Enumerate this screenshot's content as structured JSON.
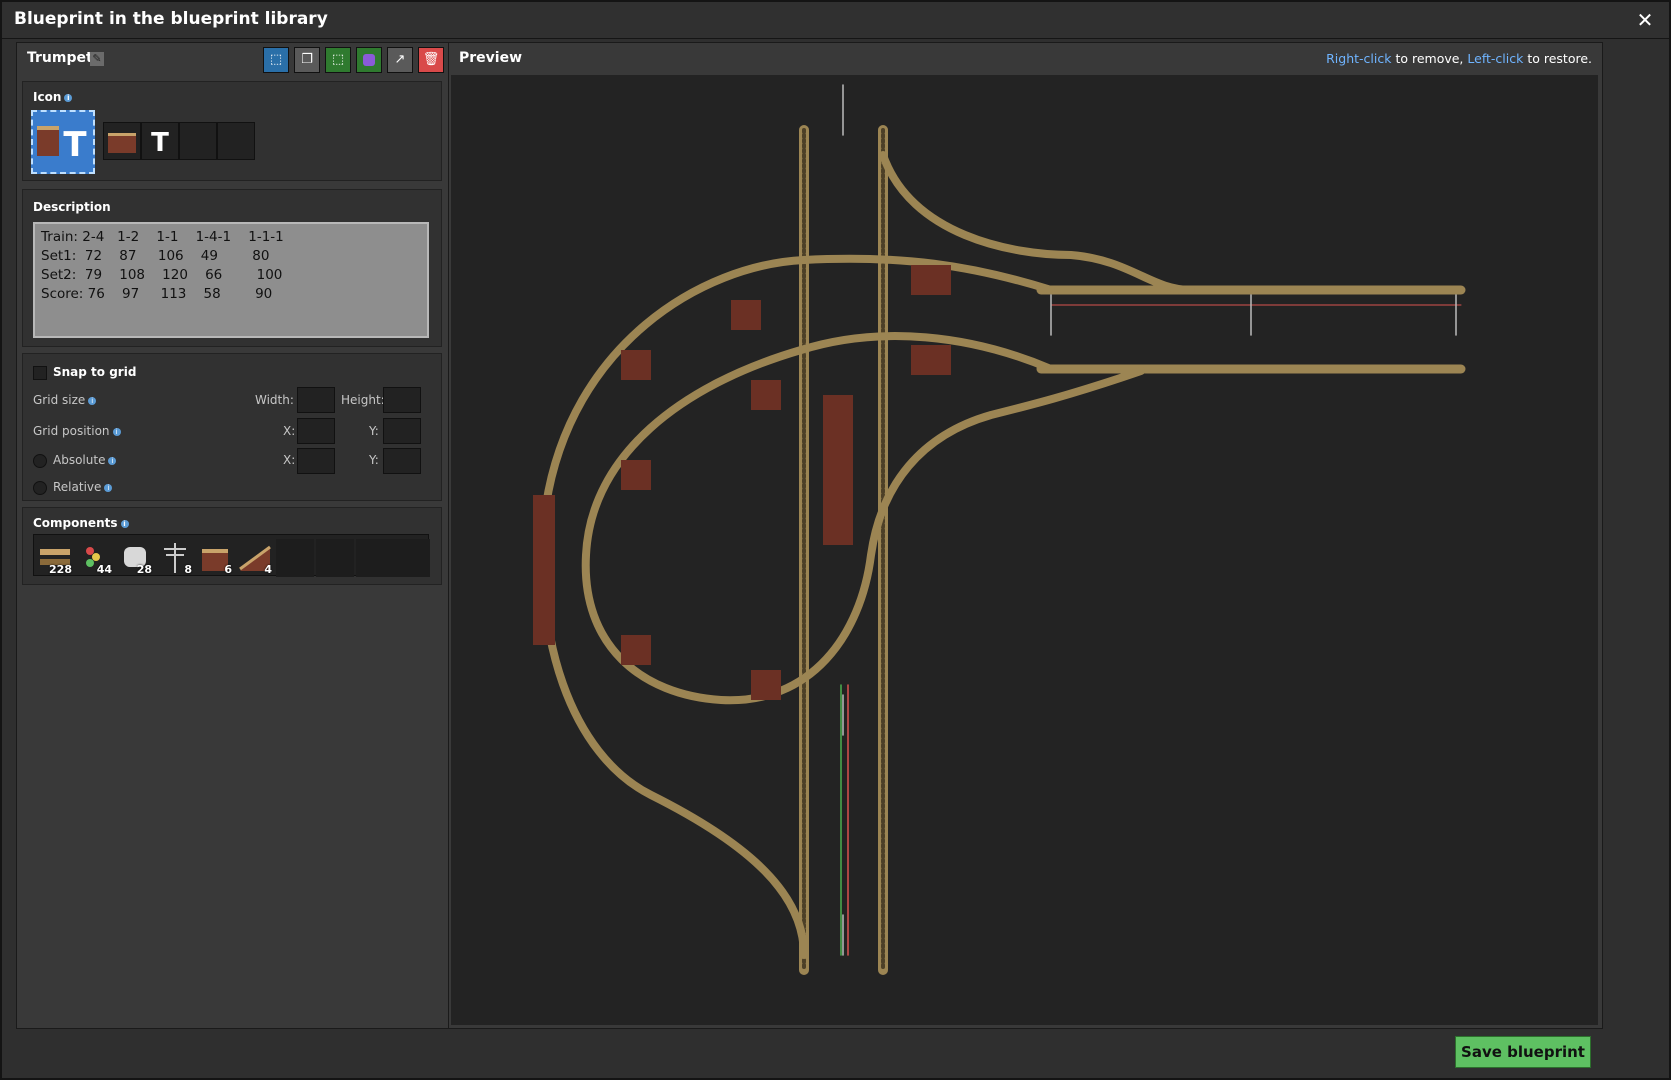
{
  "window": {
    "title": "Blueprint in the blueprint library"
  },
  "blueprint": {
    "name": "Trumpet"
  },
  "icon_section": {
    "title": "Icon"
  },
  "description": {
    "title": "Description",
    "lines": [
      "Train: 2-4   1-2    1-1    1-4-1    1-1-1",
      "Set1:  72    87     106    49        80",
      "Set2:  79    108    120    66        100",
      "Score: 76    97     113    58        90"
    ]
  },
  "grid": {
    "snap_label": "Snap to grid",
    "grid_size_label": "Grid size",
    "width_label": "Width:",
    "height_label": "Height:",
    "grid_position_label": "Grid position",
    "x_label": "X:",
    "y_label": "Y:",
    "absolute_label": "Absolute",
    "relative_label": "Relative"
  },
  "components": {
    "title": "Components",
    "items": [
      {
        "icon": "rail-icon",
        "count": "228"
      },
      {
        "icon": "rail-signal-icon",
        "count": "44"
      },
      {
        "icon": "rail-chain-signal-icon",
        "count": "28"
      },
      {
        "icon": "big-electric-pole-icon",
        "count": "8"
      },
      {
        "icon": "rail-support-icon",
        "count": "6"
      },
      {
        "icon": "elevated-rail-ramp-icon",
        "count": "4"
      }
    ]
  },
  "preview": {
    "title": "Preview",
    "hint": {
      "k1": "Right-click",
      "t1": " to remove, ",
      "k2": "Left-click",
      "t2": " to restore."
    }
  },
  "actions": {
    "save_label": "Save blueprint"
  },
  "colors": {
    "accent_blue": "#6fb4ff",
    "save_green": "#5ec062",
    "delete_red": "#d94a4a"
  }
}
